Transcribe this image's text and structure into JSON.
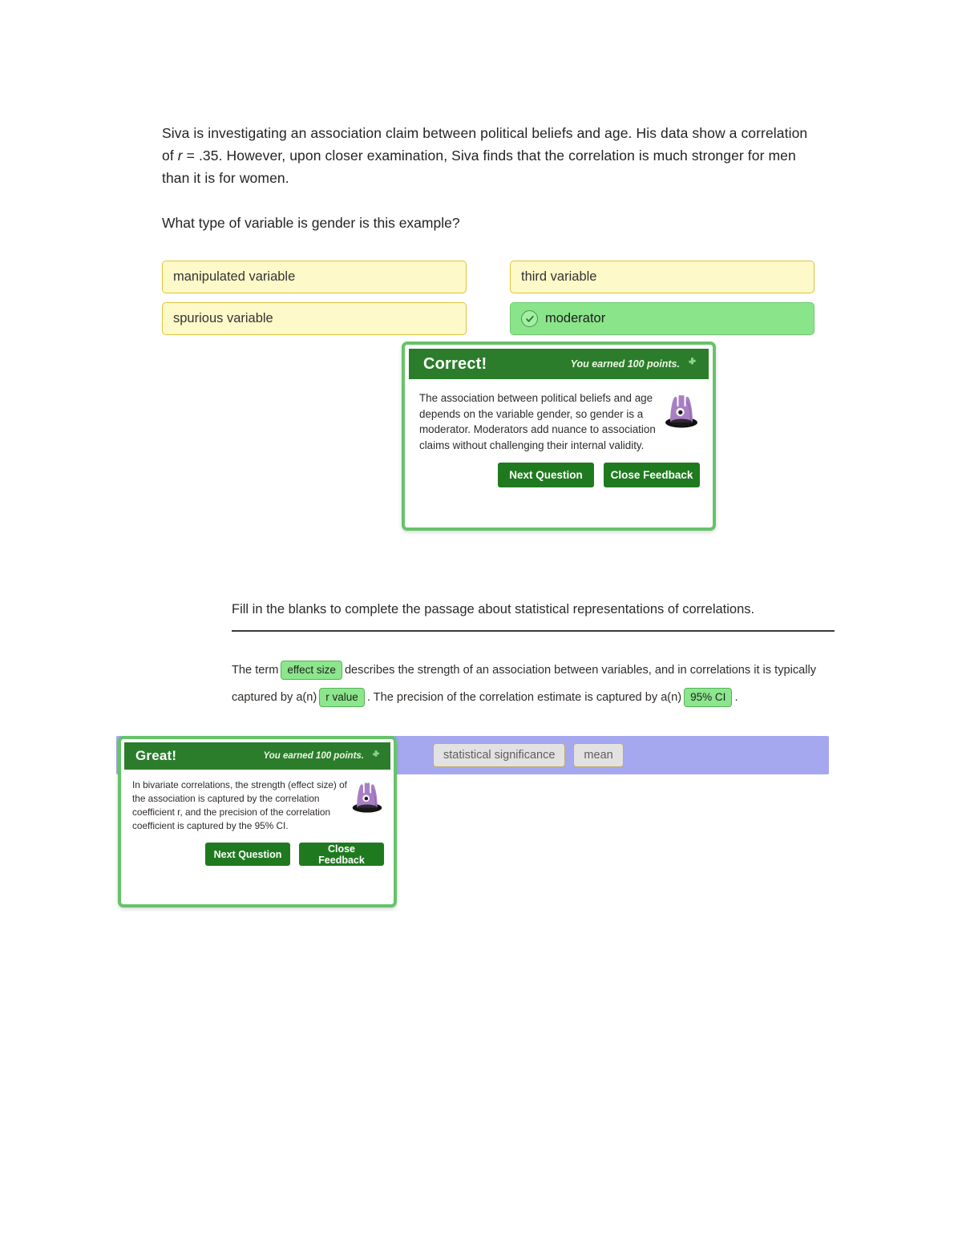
{
  "question": {
    "stem_part1": "Siva is investigating an association claim between political beliefs and age. His data show a correlation of ",
    "stem_r": "r",
    "stem_part2": " = .35. However, upon closer examination, Siva finds that the correlation is much stronger for men than it is for women.",
    "prompt": "What type of variable is gender is this example?",
    "options": [
      {
        "label": "manipulated variable",
        "selected": false
      },
      {
        "label": "third variable",
        "selected": false
      },
      {
        "label": "spurious variable",
        "selected": false
      },
      {
        "label": "moderator",
        "selected": true
      }
    ]
  },
  "feedback_correct": {
    "title": "Correct!",
    "points": "You earned 100 points.",
    "plus_icon": "plus-icon",
    "avatar_icon": "monster-avatar-icon",
    "body": "The association between political beliefs and age depends on the variable gender, so gender is a moderator. Moderators add nuance to association claims without challenging their internal validity.",
    "next_label": "Next Question",
    "close_label": "Close Feedback"
  },
  "fitb": {
    "heading": "Fill in the blanks to complete the passage about statistical representations of correlations.",
    "passage_1": "The term",
    "blank_1": "effect size",
    "passage_2": "describes the strength of an association between variables, and in correlations it is typically captured by a(n)",
    "blank_2": "r value",
    "passage_3": ". The precision of the correlation estimate is captured by a(n)",
    "blank_3": "95% CI",
    "passage_4": ".",
    "word_bank": [
      "statistical significance",
      "mean"
    ]
  },
  "feedback_great": {
    "title": "Great!",
    "points": "You earned 100 points.",
    "plus_icon": "plus-icon",
    "avatar_icon": "monster-avatar-icon",
    "body": "In bivariate correlations, the strength (effect size) of the association is captured by the correlation coefficient r, and the precision of the correlation coefficient is captured by the 95% CI.",
    "next_label": "Next Question",
    "close_label": "Close Feedback"
  },
  "colors": {
    "option_bg": "#fdf9c9",
    "option_border": "#e0c33a",
    "selected_bg": "#8ae58a",
    "feedback_header": "#2b7d2b",
    "feedback_border": "#65c36a",
    "blank_bg": "#8ce68c",
    "word_bank_bg": "#a5a8ef",
    "chip_bg": "#e2e2e2"
  }
}
